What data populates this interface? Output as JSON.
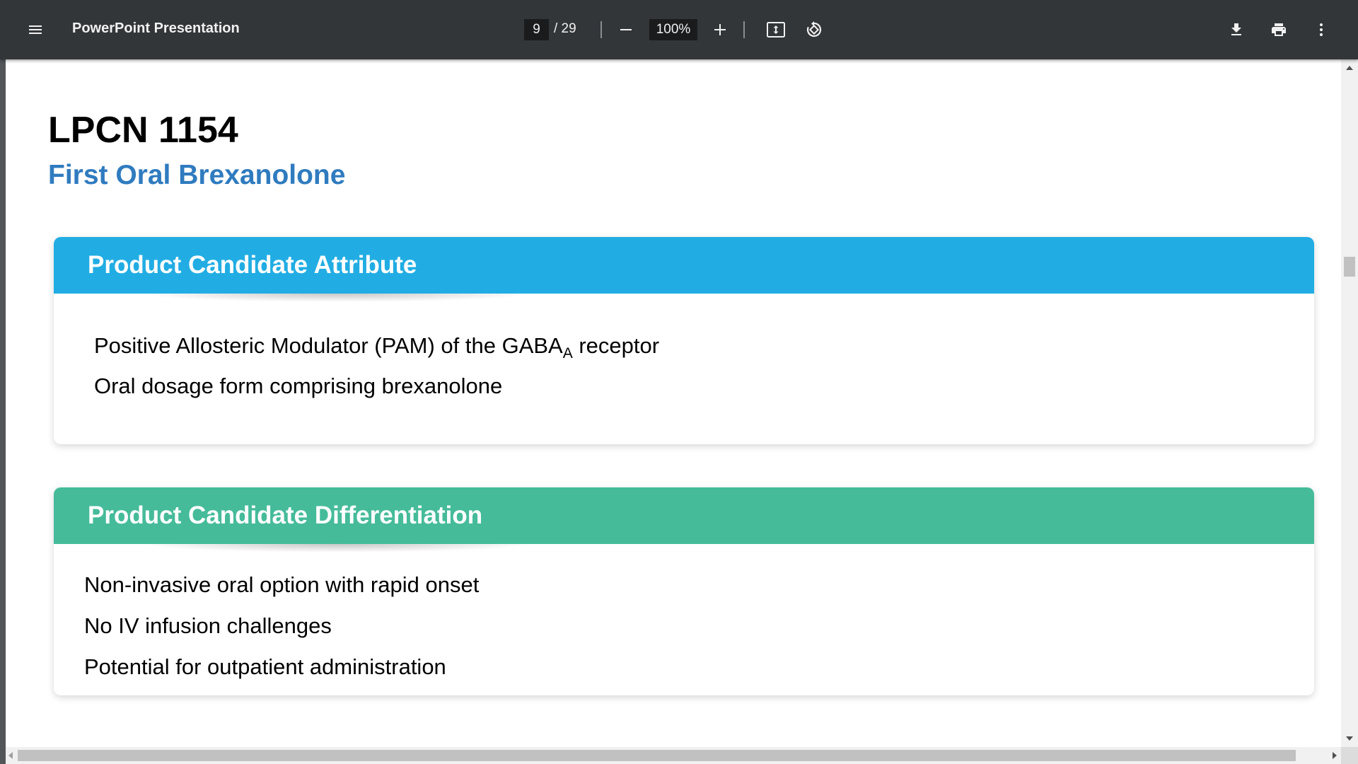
{
  "toolbar": {
    "menu_icon": "hamburger-menu-icon",
    "title": "PowerPoint Presentation",
    "page_current": "9",
    "page_total": "/ 29",
    "zoom_out_icon": "minus-icon",
    "zoom_value": "100%",
    "zoom_in_icon": "plus-icon",
    "fit_icon": "fit-to-page-icon",
    "rotate_icon": "rotate-counterclockwise-icon",
    "download_icon": "download-icon",
    "print_icon": "print-icon",
    "more_icon": "more-vertical-icon"
  },
  "slide": {
    "title": "LPCN 1154",
    "subtitle": "First Oral Brexanolone",
    "attribute_section": {
      "header": "Product Candidate Attribute",
      "color": "#21ade3",
      "bullet_1_main": "Positive Allosteric Modulator (PAM) of the GABA",
      "bullet_1_sub": "A",
      "bullet_1_tail": " receptor",
      "bullet_2": "Oral dosage form comprising brexanolone"
    },
    "differentiation_section": {
      "header": "Product Candidate Differentiation",
      "color": "#45bb9a",
      "bullets": [
        "Non-invasive oral option with rapid onset",
        "No IV infusion challenges",
        "Potential for outpatient administration"
      ]
    }
  },
  "colors": {
    "toolbar_bg": "#323639",
    "subtitle": "#2f7bbf"
  }
}
